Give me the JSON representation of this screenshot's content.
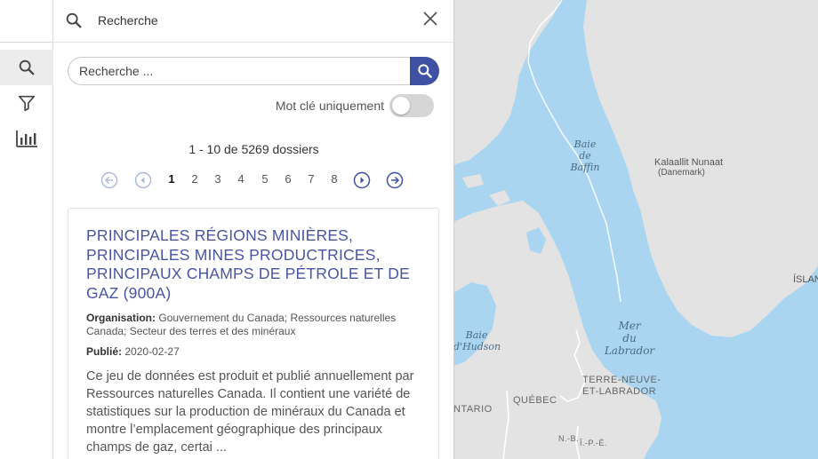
{
  "sidebar": {
    "items": [
      {
        "icon": "search-icon",
        "active": true
      },
      {
        "icon": "filter-icon",
        "active": false
      },
      {
        "icon": "chart-icon",
        "active": false
      }
    ]
  },
  "panel": {
    "header_title": "Recherche",
    "search_placeholder": "Recherche ...",
    "toggle_label": "Mot clé uniquement",
    "toggle_on": false,
    "results_count": "1 - 10 de 5269 dossiers",
    "pagination": {
      "pages": [
        "1",
        "2",
        "3",
        "4",
        "5",
        "6",
        "7",
        "8"
      ],
      "current": "1"
    }
  },
  "result": {
    "title": "PRINCIPALES RÉGIONS MINIÈRES, PRINCIPALES MINES PRODUCTRICES, PRINCIPAUX CHAMPS DE PÉTROLE ET DE GAZ (900A)",
    "organisation_label": "Organisation:",
    "organisation": "Gouvernement du Canada; Ressources naturelles Canada; Secteur des terres et des minéraux",
    "published_label": "Publié:",
    "published": "2020-02-27",
    "description": "Ce jeu de données est produit et publié annuellement par Ressources naturelles Canada. Il contient une variété de statistiques sur la production de minéraux du Canada et montre l’emplacement géographique des principaux champs de gaz, certai ..."
  },
  "map": {
    "labels": {
      "baffin_1": "Baie",
      "baffin_2": "de",
      "baffin_3": "Baffin",
      "greenland_1": "Kalaallit Nunaat",
      "greenland_2": "(Danemark)",
      "labrador_1": "Mer",
      "labrador_2": "du",
      "labrador_3": "Labrador",
      "hudson_1": "Baie",
      "hudson_2": "d'Hudson",
      "tnl_1": "TERRE-NEUVE-",
      "tnl_2": "ET-LABRADOR",
      "quebec": "QUÉBEC",
      "ontario": "NTARIO",
      "nb": "N.-B.",
      "ipe": "Î.-P.-É.",
      "islande": "ÍSLAND"
    },
    "colors": {
      "water": "#a9d5f0",
      "land": "#e3e3e3"
    }
  },
  "colors": {
    "accent": "#3f51a3",
    "title": "#4a55a2"
  }
}
